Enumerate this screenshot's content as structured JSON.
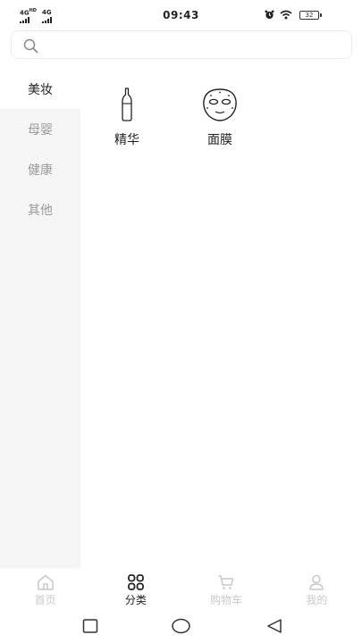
{
  "status_bar": {
    "time": "09:43",
    "network_1": "4G",
    "network_1_sup": "HD",
    "network_2": "4G",
    "battery": "32"
  },
  "search": {
    "placeholder": ""
  },
  "sidebar": {
    "items": [
      {
        "label": "美妆",
        "active": true
      },
      {
        "label": "母婴",
        "active": false
      },
      {
        "label": "健康",
        "active": false
      },
      {
        "label": "其他",
        "active": false
      }
    ]
  },
  "categories": [
    {
      "label": "精华",
      "icon": "ampoule-icon"
    },
    {
      "label": "面膜",
      "icon": "face-mask-icon"
    }
  ],
  "tab_bar": {
    "tabs": [
      {
        "label": "首页",
        "icon": "home-icon",
        "active": false
      },
      {
        "label": "分类",
        "icon": "category-icon",
        "active": true
      },
      {
        "label": "购物车",
        "icon": "cart-icon",
        "active": false
      },
      {
        "label": "我的",
        "icon": "user-icon",
        "active": false
      }
    ]
  },
  "colors": {
    "active_text": "#222222",
    "inactive_text": "#999999",
    "inactive_tab": "#c8c8c8",
    "sidebar_bg": "#f5f5f5"
  }
}
